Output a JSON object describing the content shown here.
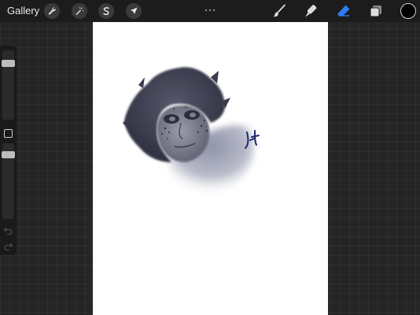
{
  "topbar": {
    "gallery_label": "Gallery",
    "left_tools": [
      {
        "name": "actions",
        "icon": "wrench-icon"
      },
      {
        "name": "adjustments",
        "icon": "magic-wand-icon"
      },
      {
        "name": "selection",
        "icon": "selection-s-icon"
      },
      {
        "name": "transform",
        "icon": "arrow-cursor-icon"
      }
    ],
    "center_menu_icon": "more-dots-icon",
    "right_tools": [
      {
        "name": "brush",
        "icon": "brush-icon",
        "active": false
      },
      {
        "name": "smudge",
        "icon": "smudge-icon",
        "active": false
      },
      {
        "name": "eraser",
        "icon": "eraser-icon",
        "active": true
      },
      {
        "name": "layers",
        "icon": "layers-icon",
        "active": false
      }
    ],
    "current_color": "#000000",
    "accent_color": "#2f7cf6"
  },
  "sidebar": {
    "brush_size_level": 0.85,
    "opacity_level": 0.3,
    "modify_icon": "square-icon",
    "undo_icon": "undo-arrow-icon",
    "redo_icon": "redo-arrow-icon"
  },
  "canvas": {
    "background": "#ffffff",
    "artwork": "portrait-sketch"
  }
}
